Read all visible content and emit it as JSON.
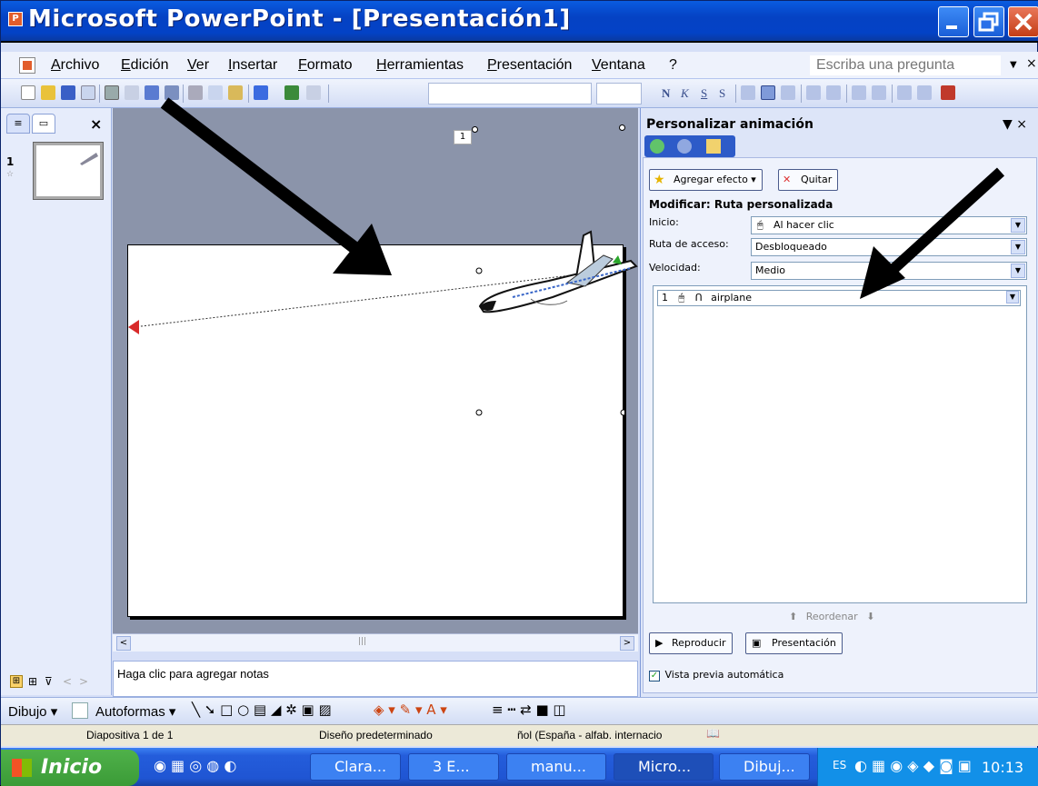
{
  "window": {
    "title": "Microsoft PowerPoint - [Presentación1]"
  },
  "menu": {
    "items": [
      "Archivo",
      "Edición",
      "Ver",
      "Insertar",
      "Formato",
      "Herramientas",
      "Presentación",
      "Ventana",
      "?"
    ],
    "ask_placeholder": "Escriba una pregunta"
  },
  "toolbar": {
    "font_format": [
      "N",
      "K",
      "S",
      "S"
    ]
  },
  "slides_pane": {
    "slide_number": "1",
    "close": "×"
  },
  "slide": {
    "number_tag": "1"
  },
  "notes": {
    "placeholder": "Haga clic para agregar notas"
  },
  "task_pane": {
    "title": "Personalizar animación",
    "add_effect": "Agregar efecto",
    "remove": "Quitar",
    "modify_heading": "Modificar: Ruta personalizada",
    "start_label": "Inicio:",
    "start_value": "Al hacer clic",
    "path_label": "Ruta de acceso:",
    "path_value": "Desbloqueado",
    "speed_label": "Velocidad:",
    "speed_value": "Medio",
    "animation_item": "airplane",
    "animation_index": "1",
    "reorder": "Reordenar",
    "play": "Reproducir",
    "slideshow": "Presentación",
    "autopreview": "Vista previa automática"
  },
  "draw_toolbar": {
    "draw": "Dibujo",
    "autoshapes": "Autoformas"
  },
  "status": {
    "slide": "Diapositiva 1 de 1",
    "design": "Diseño predeterminado",
    "language": "ñol (España - alfab. internacio"
  },
  "taskbar": {
    "start": "Inicio",
    "items": [
      "Clara...",
      "3 E...",
      "manu...",
      "Micro...",
      "Dibuj..."
    ],
    "lang": "ES",
    "clock": "10:13"
  }
}
